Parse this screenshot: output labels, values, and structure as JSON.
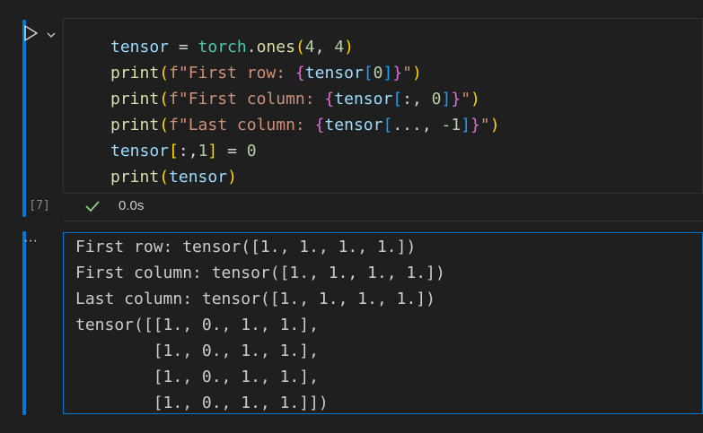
{
  "cell": {
    "execution_count": "[7]",
    "status_time": "0.0s",
    "more_label": "···",
    "code_lines": [
      [
        {
          "t": "tensor",
          "c": "t-var"
        },
        {
          "t": " = ",
          "c": "t-op"
        },
        {
          "t": "torch",
          "c": "t-mod"
        },
        {
          "t": ".",
          "c": "t-op"
        },
        {
          "t": "ones",
          "c": "t-fn"
        },
        {
          "t": "(",
          "c": "t-b1"
        },
        {
          "t": "4",
          "c": "t-num"
        },
        {
          "t": ", ",
          "c": "t-op"
        },
        {
          "t": "4",
          "c": "t-num"
        },
        {
          "t": ")",
          "c": "t-b1"
        }
      ],
      [
        {
          "t": "print",
          "c": "t-fn"
        },
        {
          "t": "(",
          "c": "t-b1"
        },
        {
          "t": "f\"First row: ",
          "c": "t-str"
        },
        {
          "t": "{",
          "c": "t-b2"
        },
        {
          "t": "tensor",
          "c": "t-var"
        },
        {
          "t": "[",
          "c": "t-b3"
        },
        {
          "t": "0",
          "c": "t-num"
        },
        {
          "t": "]",
          "c": "t-b3"
        },
        {
          "t": "}",
          "c": "t-b2"
        },
        {
          "t": "\"",
          "c": "t-str"
        },
        {
          "t": ")",
          "c": "t-b1"
        }
      ],
      [
        {
          "t": "print",
          "c": "t-fn"
        },
        {
          "t": "(",
          "c": "t-b1"
        },
        {
          "t": "f\"First column: ",
          "c": "t-str"
        },
        {
          "t": "{",
          "c": "t-b2"
        },
        {
          "t": "tensor",
          "c": "t-var"
        },
        {
          "t": "[",
          "c": "t-b3"
        },
        {
          "t": ":, ",
          "c": "t-op"
        },
        {
          "t": "0",
          "c": "t-num"
        },
        {
          "t": "]",
          "c": "t-b3"
        },
        {
          "t": "}",
          "c": "t-b2"
        },
        {
          "t": "\"",
          "c": "t-str"
        },
        {
          "t": ")",
          "c": "t-b1"
        }
      ],
      [
        {
          "t": "print",
          "c": "t-fn"
        },
        {
          "t": "(",
          "c": "t-b1"
        },
        {
          "t": "f\"Last column: ",
          "c": "t-str"
        },
        {
          "t": "{",
          "c": "t-b2"
        },
        {
          "t": "tensor",
          "c": "t-var"
        },
        {
          "t": "[",
          "c": "t-b3"
        },
        {
          "t": "..., ",
          "c": "t-op"
        },
        {
          "t": "-1",
          "c": "t-num"
        },
        {
          "t": "]",
          "c": "t-b3"
        },
        {
          "t": "}",
          "c": "t-b2"
        },
        {
          "t": "\"",
          "c": "t-str"
        },
        {
          "t": ")",
          "c": "t-b1"
        }
      ],
      [
        {
          "t": "tensor",
          "c": "t-var"
        },
        {
          "t": "[",
          "c": "t-b1"
        },
        {
          "t": ":,",
          "c": "t-op"
        },
        {
          "t": "1",
          "c": "t-num"
        },
        {
          "t": "]",
          "c": "t-b1"
        },
        {
          "t": " = ",
          "c": "t-op"
        },
        {
          "t": "0",
          "c": "t-num"
        }
      ],
      [
        {
          "t": "print",
          "c": "t-fn"
        },
        {
          "t": "(",
          "c": "t-b1"
        },
        {
          "t": "tensor",
          "c": "t-var"
        },
        {
          "t": ")",
          "c": "t-b1"
        }
      ]
    ],
    "output_lines": [
      "First row: tensor([1., 1., 1., 1.])",
      "First column: tensor([1., 1., 1., 1.])",
      "Last column: tensor([1., 1., 1., 1.])",
      "tensor([[1., 0., 1., 1.],",
      "        [1., 0., 1., 1.],",
      "        [1., 0., 1., 1.],",
      "        [1., 0., 1., 1.]])"
    ]
  },
  "colors": {
    "accent": "#0078d4",
    "success": "#89d185",
    "background": "#1f1f1f"
  },
  "icons": {
    "run": "play-icon",
    "run_menu": "chevron-down-icon",
    "status": "checkmark-icon",
    "output_menu": "more-icon"
  }
}
